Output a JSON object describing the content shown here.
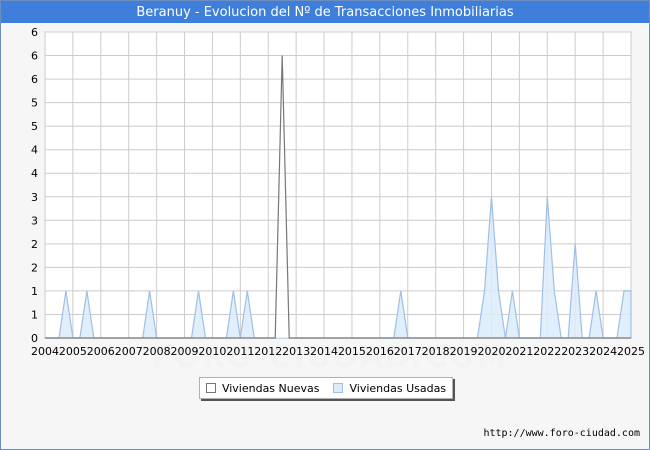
{
  "header": {
    "title": "Beranuy - Evolucion del Nº de Transacciones Inmobiliarias"
  },
  "footer": {
    "url": "http://www.foro-ciudad.com"
  },
  "watermark": "FORO-CIUDAD.COM",
  "colors": {
    "title_bg": "#3f7fdb",
    "nuevas_line": "#777777",
    "nuevas_fill": "#ffffff",
    "usadas_line": "#9fc0e6",
    "usadas_fill": "#dcebfa",
    "grid": "#cccccc",
    "plot_bg": "#ffffff"
  },
  "chart_data": {
    "type": "area",
    "title": "Beranuy - Evolucion del Nº de Transacciones Inmobiliarias",
    "xlabel": "",
    "ylabel": "",
    "xlim": [
      2004,
      2025
    ],
    "ylim": [
      0,
      6.5
    ],
    "x_tick_labels": [
      "2004",
      "2005",
      "2006",
      "2007",
      "2008",
      "2009",
      "2010",
      "2011",
      "2012",
      "2013",
      "2014",
      "2015",
      "2016",
      "2017",
      "2018",
      "2019",
      "2020",
      "2021",
      "2022",
      "2023",
      "2024",
      "2025"
    ],
    "y_tick_labels": [
      "0",
      "1",
      "1",
      "2",
      "2",
      "3",
      "3",
      "4",
      "4",
      "5",
      "5",
      "6",
      "6",
      "6"
    ],
    "grid": true,
    "legend_position": "bottom",
    "series": [
      {
        "name": "Viviendas Nuevas",
        "points": [
          [
            2004,
            0
          ],
          [
            2012.25,
            0
          ],
          [
            2012.5,
            6
          ],
          [
            2012.75,
            0
          ],
          [
            2025,
            0
          ]
        ]
      },
      {
        "name": "Viviendas Usadas",
        "points": [
          [
            2004,
            0
          ],
          [
            2004.5,
            0
          ],
          [
            2004.75,
            1
          ],
          [
            2005,
            0
          ],
          [
            2005.25,
            0
          ],
          [
            2005.5,
            1
          ],
          [
            2005.75,
            0
          ],
          [
            2007.5,
            0
          ],
          [
            2007.75,
            1
          ],
          [
            2008,
            0
          ],
          [
            2009.25,
            0
          ],
          [
            2009.5,
            1
          ],
          [
            2009.75,
            0
          ],
          [
            2010.5,
            0
          ],
          [
            2010.75,
            1
          ],
          [
            2011,
            0
          ],
          [
            2011.25,
            1
          ],
          [
            2011.5,
            0
          ],
          [
            2016.5,
            0
          ],
          [
            2016.75,
            1
          ],
          [
            2017,
            0
          ],
          [
            2019.5,
            0
          ],
          [
            2019.75,
            1
          ],
          [
            2020,
            3
          ],
          [
            2020.25,
            1
          ],
          [
            2020.5,
            0
          ],
          [
            2020.75,
            1
          ],
          [
            2021,
            0
          ],
          [
            2021.75,
            0
          ],
          [
            2022,
            3
          ],
          [
            2022.25,
            1
          ],
          [
            2022.5,
            0
          ],
          [
            2022.75,
            0
          ],
          [
            2023,
            2
          ],
          [
            2023.25,
            0
          ],
          [
            2023.5,
            0
          ],
          [
            2023.75,
            1
          ],
          [
            2024,
            0
          ],
          [
            2024.5,
            0
          ],
          [
            2024.75,
            1
          ],
          [
            2025,
            1
          ],
          [
            2025,
            0
          ]
        ]
      }
    ]
  }
}
